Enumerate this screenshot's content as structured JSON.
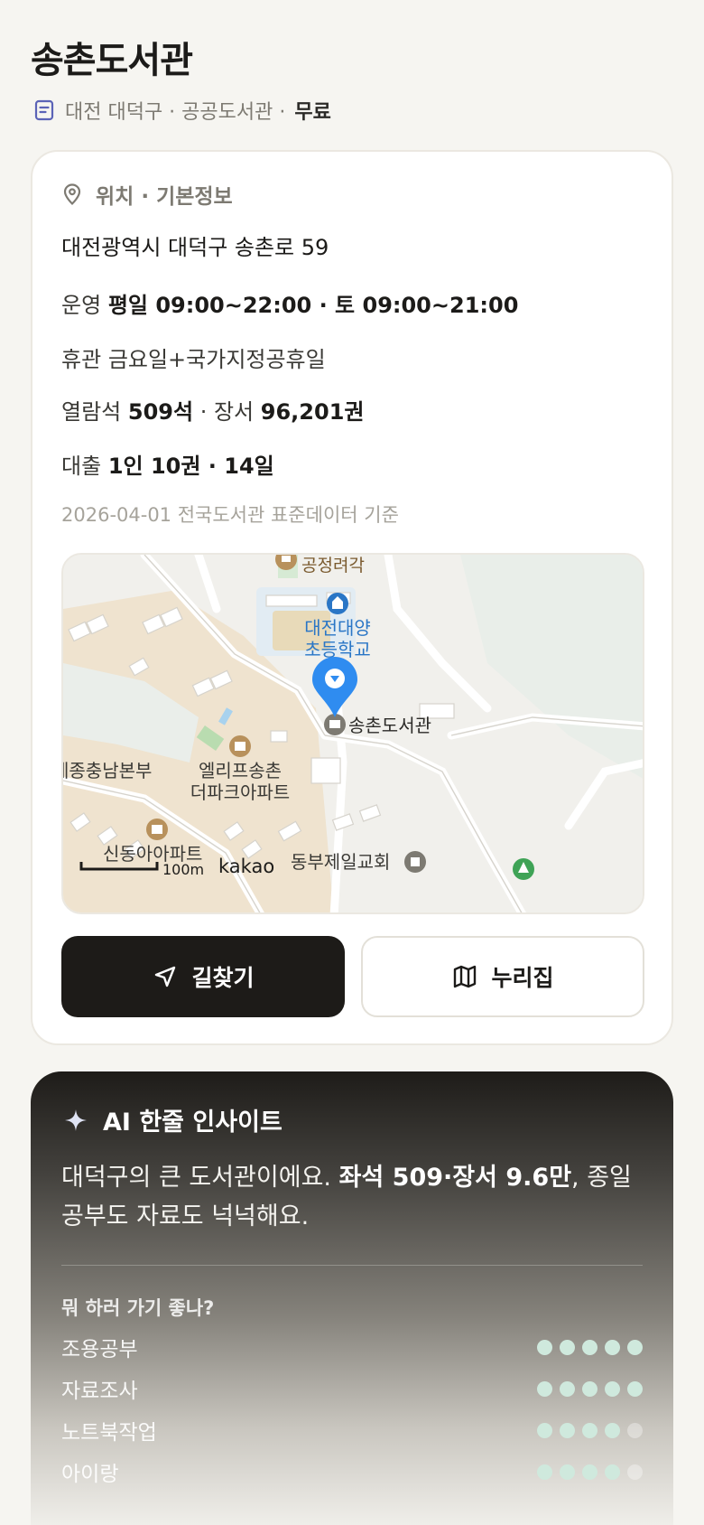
{
  "header": {
    "title": "송촌도서관",
    "subline": "대전 대덕구 · 공공도서관 ·",
    "fee": "무료"
  },
  "info": {
    "section_title": "위치 · 기본정보",
    "address": "대전광역시 대덕구 송촌로 59",
    "hours_label": "운영",
    "hours_value": "평일 09:00~22:00 · 토 09:00~21:00",
    "closed_label": "휴관",
    "closed_value": "금요일+국가지정공휴일",
    "seats_label": "열람석",
    "seats_value": "509석",
    "books_label": "· 장서",
    "books_value": "96,201권",
    "loan_label": "대출",
    "loan_value": "1인 10권 · 14일",
    "source": "2026-04-01 전국도서관 표준데이터 기준"
  },
  "map": {
    "labels": {
      "pavilion": "공정려각",
      "school_line1": "대전대양",
      "school_line2": "초등학교",
      "library": "송촌도서관",
      "apt1_line1": "엘리프송촌",
      "apt1_line2": "더파크아파트",
      "area": "세종충남본부",
      "apt2": "신동아아파트",
      "church": "동부제일교회",
      "scale": "100m",
      "brand": "kakao"
    },
    "colors": {
      "pin": "#2f8cf0",
      "school_text": "#2a76c6",
      "poi": "#b8915c",
      "park": "#3fa356"
    }
  },
  "buttons": {
    "directions": "길찾기",
    "website": "누리집"
  },
  "ai": {
    "title": "AI 한줄 인사이트",
    "text_prefix": "대덕구의 큰 도서관이에요.",
    "text_bold": "좌석 509·장서 9.6만",
    "text_suffix": ", 종일 공부도 자료도 넉넉해요.",
    "question": "뭐 하러 가기 좋나?",
    "ratings": [
      {
        "label": "조용공부",
        "score": 5
      },
      {
        "label": "자료조사",
        "score": 5
      },
      {
        "label": "노트북작업",
        "score": 4
      },
      {
        "label": "아이랑",
        "score": 4
      }
    ]
  }
}
